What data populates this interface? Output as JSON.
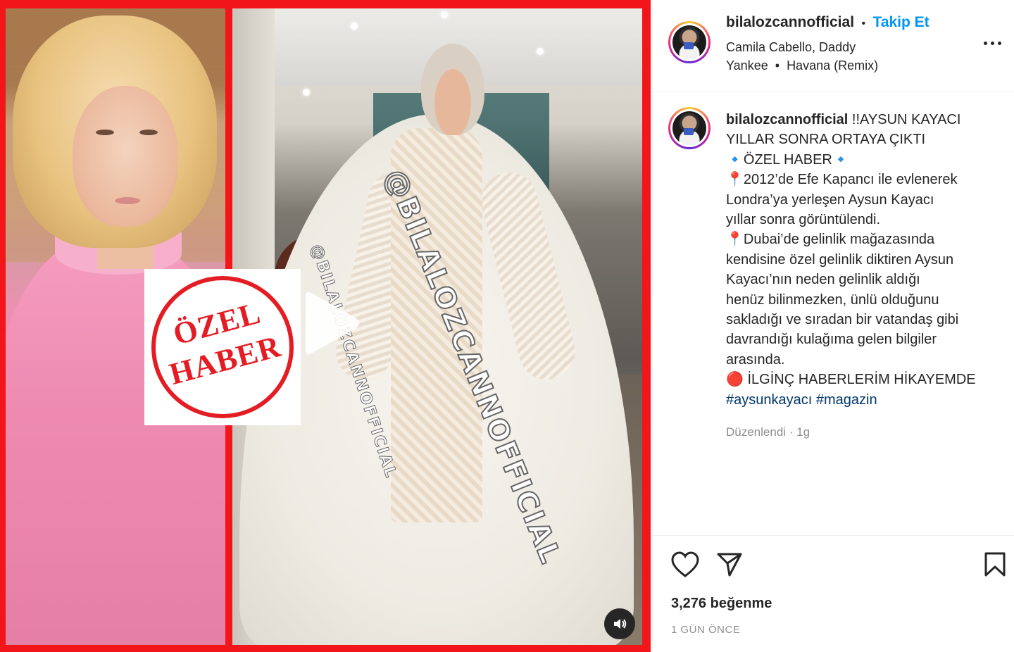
{
  "post": {
    "username": "bilalozcannofficial",
    "follow_label": "Takip Et",
    "separator": "•",
    "audio_line1": "Camila Cabello, Daddy",
    "audio_line2": "Yankee",
    "audio_song": "Havana (Remix)"
  },
  "media": {
    "stamp_line1": "ÖZEL",
    "stamp_line2": "HABER",
    "watermark_big": "@BILALOZCANNOFFICIAL",
    "watermark_small": "@BILALOZCANNOFFICIAL",
    "play_icon": "play-icon",
    "mute_icon": "speaker-icon"
  },
  "caption": {
    "username": "bilalozcannofficial",
    "lines": [
      "!!AYSUN KAYACI",
      "YILLAR SONRA ORTAYA ÇIKTI",
      "🔹ÖZEL HABER🔹",
      "📍2012’de Efe Kapancı ile evlenerek",
      "Londra’ya yerleşen Aysun Kayacı",
      "yıllar sonra görüntülendi.",
      "📍Dubai’de gelinlik mağazasında",
      "kendisine özel gelinlik diktiren Aysun",
      "Kayacı’nın neden gelinlik aldığı",
      "henüz bilinmezken, ünlü olduğunu",
      "sakladığı ve sıradan bir vatandaş gibi",
      "davrandığı kulağıma gelen bilgiler",
      "arasında.",
      "🔴 İLGİNÇ HABERLERİM HİKAYEMDE"
    ],
    "hashtags": "#aysunkayacı #magazin",
    "edited": "Düzenlendi · 1g"
  },
  "footer": {
    "likes": "3,276 beğenme",
    "time": "1 GÜN ÖNCE"
  },
  "colors": {
    "frame_red": "#f2161a",
    "follow_blue": "#0095f6",
    "hashtag_blue": "#00376b"
  }
}
